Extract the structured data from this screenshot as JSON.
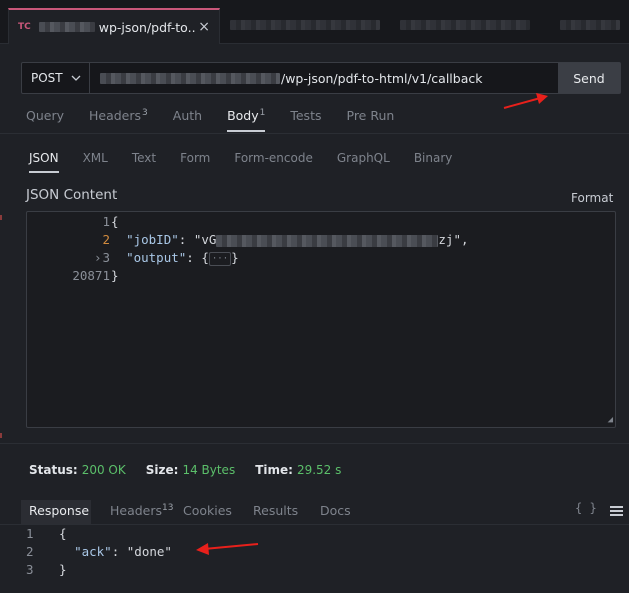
{
  "tabbar": {
    "active_tab": {
      "badge": "TC",
      "title": "wp-json/pdf-to..",
      "close": "×"
    }
  },
  "request": {
    "method": "POST",
    "url_suffix": "/wp-json/pdf-to-html/v1/callback",
    "send_label": "Send",
    "tabs": [
      {
        "label": "Query",
        "count": ""
      },
      {
        "label": "Headers",
        "count": "3"
      },
      {
        "label": "Auth",
        "count": ""
      },
      {
        "label": "Body",
        "count": "1"
      },
      {
        "label": "Tests",
        "count": ""
      },
      {
        "label": "Pre Run",
        "count": ""
      }
    ],
    "active_tab": "Body"
  },
  "body_types": [
    "JSON",
    "XML",
    "Text",
    "Form",
    "Form-encode",
    "GraphQL",
    "Binary"
  ],
  "active_body_type": "JSON",
  "json_content": {
    "title": "JSON Content",
    "format_label": "Format",
    "lines": [
      {
        "num": "1",
        "text": "{"
      },
      {
        "num": "2",
        "key": "\"jobID\"",
        "value_start": "\"vG",
        "value_end": "zj\","
      },
      {
        "num": "3",
        "key": "\"output\"",
        "collapsed": "···"
      },
      {
        "num": "20871",
        "text": "}"
      }
    ]
  },
  "status": {
    "status_label": "Status:",
    "status_value": "200 OK",
    "size_label": "Size:",
    "size_value": "14 Bytes",
    "time_label": "Time:",
    "time_value": "29.52 s"
  },
  "response": {
    "tabs": [
      {
        "label": "Response",
        "count": ""
      },
      {
        "label": "Headers",
        "count": "13"
      },
      {
        "label": "Cookies",
        "count": ""
      },
      {
        "label": "Results",
        "count": ""
      },
      {
        "label": "Docs",
        "count": ""
      }
    ],
    "braces_icon": "{ }",
    "lines": [
      {
        "num": "1",
        "text": "{"
      },
      {
        "num": "2",
        "key": "\"ack\"",
        "value": "\"done\""
      },
      {
        "num": "3",
        "text": "}"
      }
    ]
  },
  "colors": {
    "accent": "#c9577a",
    "status_ok": "#5bbf6a",
    "arrow": "#e8201b"
  }
}
